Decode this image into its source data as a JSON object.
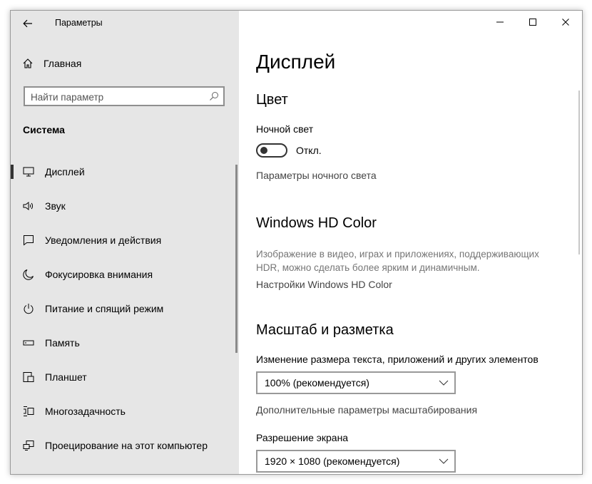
{
  "window": {
    "title": "Параметры"
  },
  "sidebar": {
    "home_label": "Главная",
    "search_placeholder": "Найти параметр",
    "section_title": "Система",
    "items": [
      {
        "label": "Дисплей",
        "icon": "monitor-icon",
        "active": true
      },
      {
        "label": "Звук",
        "icon": "speaker-icon"
      },
      {
        "label": "Уведомления и действия",
        "icon": "notification-icon"
      },
      {
        "label": "Фокусировка внимания",
        "icon": "moon-icon"
      },
      {
        "label": "Питание и спящий режим",
        "icon": "power-icon"
      },
      {
        "label": "Память",
        "icon": "storage-icon"
      },
      {
        "label": "Планшет",
        "icon": "tablet-icon"
      },
      {
        "label": "Многозадачность",
        "icon": "multitasking-icon"
      },
      {
        "label": "Проецирование на этот компьютер",
        "icon": "projecting-icon"
      }
    ]
  },
  "main": {
    "title": "Дисплей",
    "color": {
      "heading": "Цвет",
      "night_light_label": "Ночной свет",
      "night_light_state": "Откл.",
      "night_light_link": "Параметры ночного света"
    },
    "hdr": {
      "heading": "Windows HD Color",
      "description": "Изображение в видео, играх и приложениях, поддерживающих HDR, можно сделать более ярким и динамичным.",
      "link": "Настройки Windows HD Color"
    },
    "scale": {
      "heading": "Масштаб и разметка",
      "scale_label": "Изменение размера текста, приложений и других элементов",
      "scale_value": "100% (рекомендуется)",
      "advanced_link": "Дополнительные параметры масштабирования",
      "resolution_label": "Разрешение экрана",
      "resolution_value": "1920 × 1080 (рекомендуется)"
    }
  }
}
